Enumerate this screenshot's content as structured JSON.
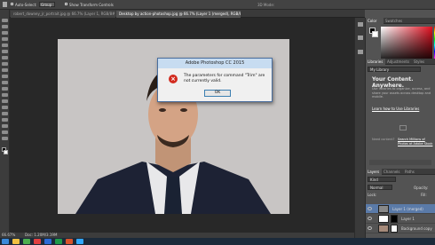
{
  "options_bar": {
    "auto_select_label": "Auto-Select:",
    "auto_select_value": "Group",
    "show_transform_label": "Show Transform Controls",
    "mode_3d_label": "3D Mode:"
  },
  "tabs": [
    {
      "label": "robert_downey_jr_portrait.jpg @ 66.7% (Layer 1, RGB/8#) *",
      "active": false
    },
    {
      "label": "Desktop by action-photoshop.jpg @ 66.7% (Layer 1 (merged), RGB/8#) *",
      "active": true
    }
  ],
  "dialog": {
    "title": "Adobe Photoshop CC 2015",
    "message": "The parameters for command \"Trim\" are not currently valid.",
    "ok_label": "OK"
  },
  "status": {
    "zoom": "66.67%",
    "doc_size": "Doc: 1.20M/3.19M"
  },
  "color_panel": {
    "tab_color": "Color",
    "tab_swatches": "Swatches"
  },
  "libraries": {
    "tabs": [
      "Libraries",
      "Adjustments",
      "Styles"
    ],
    "dropdown": "My Library",
    "heading": "Your Content. Anywhere.",
    "body": "Use libraries to organize, access, and share your assets across desktop and mobile.",
    "learn_link": "Learn how to Use Libraries",
    "need_content": "Need content?",
    "search_link": "Search Millions of Photos at Adobe Stock"
  },
  "layers_panel": {
    "tabs": [
      "Layers",
      "Channels",
      "Paths"
    ],
    "kind_label": "Kind",
    "blend_mode": "Normal",
    "opacity_label": "Opacity:",
    "fill_label": "Fill:",
    "lock_label": "Lock:",
    "layers": [
      {
        "name": "Layer 1 (merged)",
        "selected": true
      },
      {
        "name": "Layer 1",
        "selected": false
      },
      {
        "name": "Background copy",
        "selected": false
      }
    ]
  }
}
